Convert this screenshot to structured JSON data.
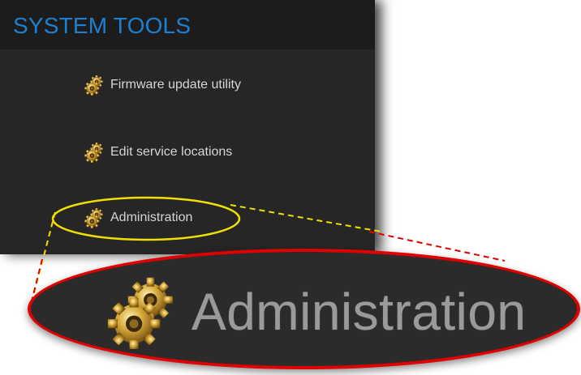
{
  "panel": {
    "title": "SYSTEM TOOLS",
    "items": [
      {
        "label": "Firmware update utility",
        "icon": "gear-icon"
      },
      {
        "label": "Edit service locations",
        "icon": "gear-icon"
      },
      {
        "label": "Administration",
        "icon": "gear-icon"
      }
    ]
  },
  "zoom": {
    "label": "Administration",
    "icon": "gear-icon"
  },
  "colors": {
    "panel_bg": "#262626",
    "title": "#1f7fd1",
    "highlight_ellipse": "#f0e000",
    "zoom_border": "#e00000",
    "connector_yellow": "#f0e000",
    "connector_red": "#e00000"
  }
}
